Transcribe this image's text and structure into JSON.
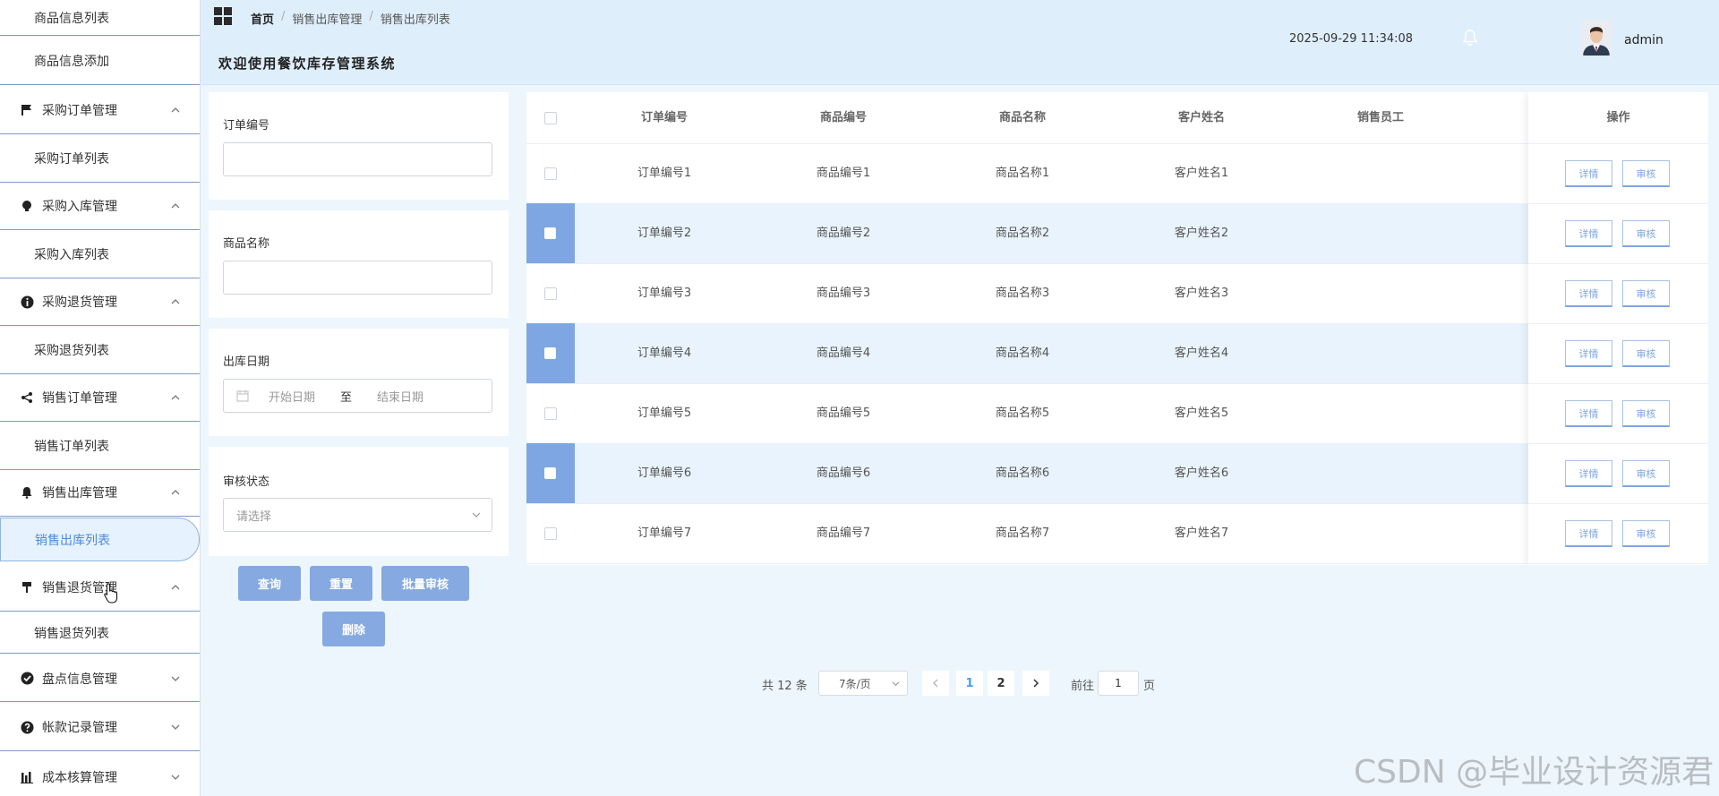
{
  "sidebar": {
    "items": [
      {
        "label": "商品信息列表"
      },
      {
        "label": "商品信息添加"
      },
      {
        "label": "采购订单管理"
      },
      {
        "label": "采购订单列表"
      },
      {
        "label": "采购入库管理"
      },
      {
        "label": "采购入库列表"
      },
      {
        "label": "采购退货管理"
      },
      {
        "label": "采购退货列表"
      },
      {
        "label": "销售订单管理"
      },
      {
        "label": "销售订单列表"
      },
      {
        "label": "销售出库管理"
      },
      {
        "label": "销售出库列表"
      },
      {
        "label": "销售退货管理"
      },
      {
        "label": "销售退货列表"
      },
      {
        "label": "盘点信息管理"
      },
      {
        "label": "帐款记录管理"
      },
      {
        "label": "成本核算管理"
      }
    ]
  },
  "header": {
    "breadcrumb": [
      "首页",
      "销售出库管理",
      "销售出库列表"
    ],
    "sep": "/",
    "title": "欢迎使用餐饮库存管理系统",
    "datetime": "2025-09-29 11:34:08",
    "username": "admin"
  },
  "filters": {
    "order_no": {
      "label": "订单编号",
      "value": ""
    },
    "product_name": {
      "label": "商品名称",
      "value": ""
    },
    "out_date": {
      "label": "出库日期",
      "start": "开始日期",
      "to": "至",
      "end": "结束日期"
    },
    "audit_status": {
      "label": "审核状态",
      "placeholder": "请选择"
    }
  },
  "buttons": {
    "query": "查询",
    "reset": "重置",
    "batch_audit": "批量审核",
    "delete": "删除"
  },
  "table": {
    "headers": {
      "order_no": "订单编号",
      "product_no": "商品编号",
      "product_name": "商品名称",
      "customer": "客户姓名",
      "staff": "销售员工",
      "ops": "操作"
    },
    "rows": [
      {
        "order_no": "订单编号1",
        "product_no": "商品编号1",
        "product_name": "商品名称1",
        "customer": "客户姓名1",
        "staff": "",
        "checked": false
      },
      {
        "order_no": "订单编号2",
        "product_no": "商品编号2",
        "product_name": "商品名称2",
        "customer": "客户姓名2",
        "staff": "",
        "checked": true
      },
      {
        "order_no": "订单编号3",
        "product_no": "商品编号3",
        "product_name": "商品名称3",
        "customer": "客户姓名3",
        "staff": "",
        "checked": false
      },
      {
        "order_no": "订单编号4",
        "product_no": "商品编号4",
        "product_name": "商品名称4",
        "customer": "客户姓名4",
        "staff": "",
        "checked": true
      },
      {
        "order_no": "订单编号5",
        "product_no": "商品编号5",
        "product_name": "商品名称5",
        "customer": "客户姓名5",
        "staff": "",
        "checked": false
      },
      {
        "order_no": "订单编号6",
        "product_no": "商品编号6",
        "product_name": "商品名称6",
        "customer": "客户姓名6",
        "staff": "",
        "checked": true
      },
      {
        "order_no": "订单编号7",
        "product_no": "商品编号7",
        "product_name": "商品名称7",
        "customer": "客户姓名7",
        "staff": "",
        "checked": false
      }
    ],
    "detail_label": "详情",
    "audit_label": "审核"
  },
  "pagination": {
    "total_text": "共 12 条",
    "page_size": "7条/页",
    "pages": [
      "1",
      "2"
    ],
    "current": "1",
    "goto_prefix": "前往",
    "goto_value": "1",
    "goto_suffix": "页"
  },
  "watermark": "CSDN @毕业设计资源君",
  "colors": {
    "accent": "#85a9e0",
    "header_bg": "#dfeefb",
    "page_bg": "#edf6fd",
    "stripe": "#e8f3fd"
  }
}
